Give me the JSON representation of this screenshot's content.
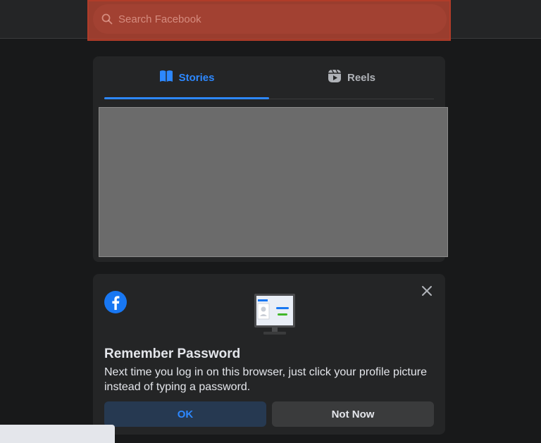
{
  "header": {
    "search": {
      "placeholder": "Search Facebook",
      "icon": "search-icon"
    }
  },
  "stories_card": {
    "tabs": [
      {
        "label": "Stories",
        "icon": "book-icon",
        "active": true
      },
      {
        "label": "Reels",
        "icon": "reels-icon",
        "active": false
      }
    ]
  },
  "remember_password": {
    "title": "Remember Password",
    "description": "Next time you log in on this browser, just click your profile picture instead of typing a password.",
    "ok_label": "OK",
    "not_now_label": "Not Now"
  },
  "colors": {
    "accent": "#2d88ff",
    "background": "#18191a",
    "card": "#242526",
    "highlight": "#c84632"
  }
}
